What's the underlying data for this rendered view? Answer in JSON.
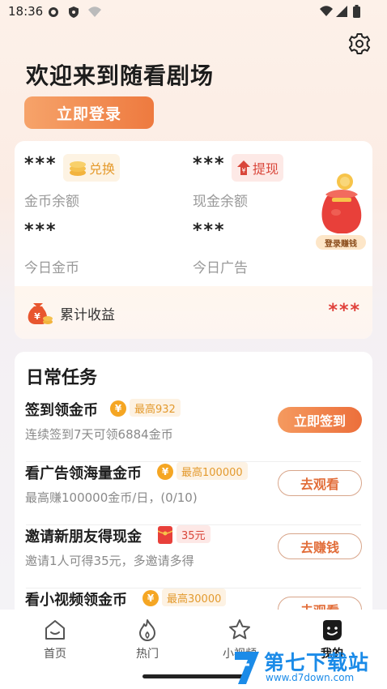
{
  "status_bar": {
    "time": "18:36"
  },
  "header": {
    "welcome": "欢迎来到随看剧场",
    "login_button": "立即登录"
  },
  "wallet": {
    "coins_value": "***",
    "exchange_label": "兑换",
    "coins_label": "金币余额",
    "cash_value": "***",
    "withdraw_label": "提现",
    "cash_label": "现金余额",
    "today_coins_value": "***",
    "today_coins_label": "今日金币",
    "today_ads_value": "***",
    "today_ads_label": "今日广告",
    "gift_label": "登录赚钱",
    "total_label": "累计收益",
    "total_value": "***"
  },
  "tasks": {
    "title": "日常任务",
    "items": [
      {
        "title": "签到领金币",
        "tag": "最高932",
        "subtitle": "连续签到7天可领6884金币",
        "button": "立即签到"
      },
      {
        "title": "看广告领海量金币",
        "tag": "最高100000",
        "subtitle": "最高赚100000金币/日，(0/10)",
        "button": "去观看"
      },
      {
        "title": "邀请新朋友得现金",
        "tag": "35元",
        "subtitle": "邀请1人可得35元，多邀请多得",
        "button": "去赚钱"
      },
      {
        "title": "看小视频领金币",
        "tag": "最高30000",
        "subtitle": "",
        "button": "去观看"
      }
    ]
  },
  "tabbar": {
    "items": [
      {
        "label": "首页",
        "icon": "home-icon"
      },
      {
        "label": "热门",
        "icon": "flame-icon"
      },
      {
        "label": "小视频",
        "icon": "star-icon"
      },
      {
        "label": "我的",
        "icon": "profile-icon"
      }
    ]
  },
  "watermark": {
    "title": "第七下载站",
    "url": "www.d7down.com"
  },
  "colors": {
    "accent": "#ee7a3f",
    "red": "#e0413b",
    "gold": "#f5a623",
    "watermark": "#1b8be8"
  }
}
